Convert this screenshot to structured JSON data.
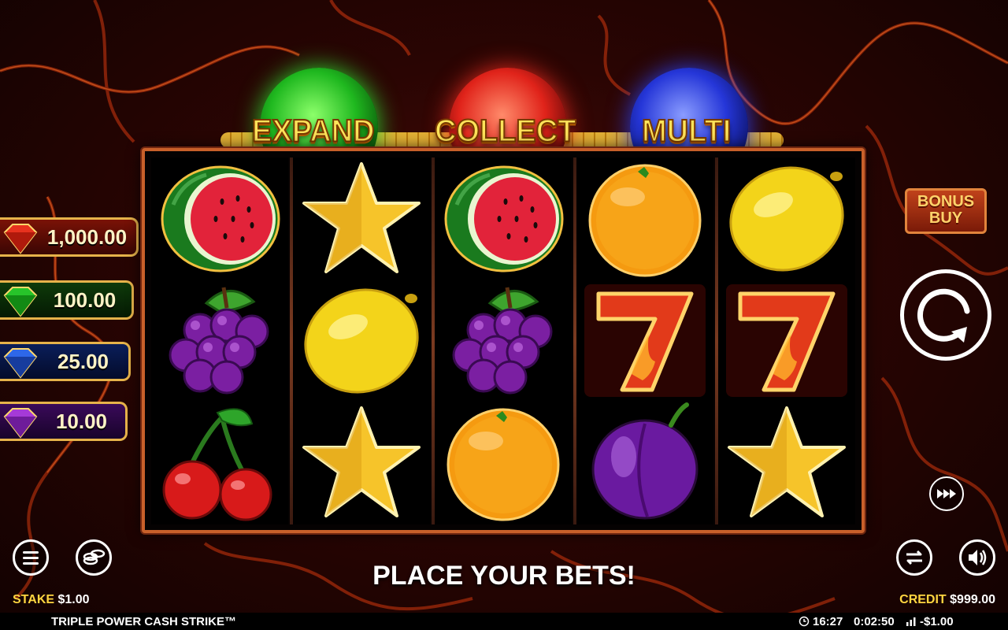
{
  "features": [
    {
      "label": "EXPAND",
      "color": "#2fd12f"
    },
    {
      "label": "COLLECT",
      "color": "#e52a1e"
    },
    {
      "label": "MULTI",
      "color": "#2a3ee5"
    }
  ],
  "jackpots": [
    {
      "value": "1,000.00",
      "gem": "red-gem",
      "color": "#e8321e"
    },
    {
      "value": "100.00",
      "gem": "green-gem",
      "color": "#27c42a"
    },
    {
      "value": "25.00",
      "gem": "blue-gem",
      "color": "#2e67e8"
    },
    {
      "value": "10.00",
      "gem": "purple-gem",
      "color": "#a53ad8"
    }
  ],
  "reels": [
    [
      "watermelon",
      "grapes",
      "cherries"
    ],
    [
      "star",
      "lemon",
      "star"
    ],
    [
      "watermelon",
      "grapes",
      "orange"
    ],
    [
      "orange",
      "seven",
      "plum"
    ],
    [
      "lemon",
      "seven",
      "star"
    ]
  ],
  "bonus_buy": {
    "line1": "BONUS",
    "line2": "BUY"
  },
  "message": "PLACE YOUR BETS!",
  "stake": {
    "label": "STAKE",
    "value": "$1.00"
  },
  "credit": {
    "label": "CREDIT",
    "value": "$999.00"
  },
  "game_title": "TRIPLE POWER CASH STRIKE™",
  "status": {
    "clock": "16:27",
    "session_time": "0:02:50",
    "net": "-$1.00"
  },
  "icons": [
    "menu-icon",
    "coins-icon",
    "spin-icon",
    "turbo-icon",
    "autoplay-icon",
    "sound-icon",
    "clock-icon",
    "chart-icon"
  ]
}
